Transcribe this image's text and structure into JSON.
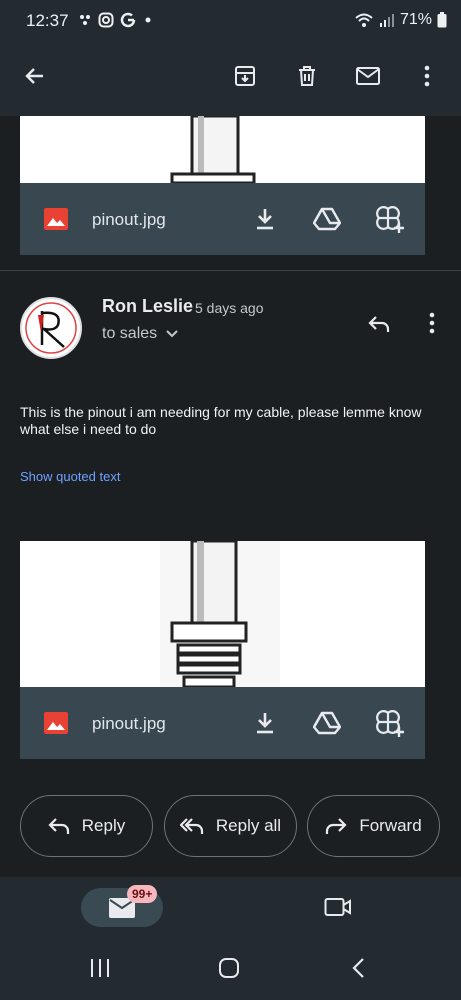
{
  "status": {
    "time": "12:37",
    "battery": "71%"
  },
  "attachments": [
    {
      "filename": "pinout.jpg"
    },
    {
      "filename": "pinout.jpg"
    }
  ],
  "message": {
    "sender": "Ron Leslie",
    "time": "5 days ago",
    "recipient": "to sales",
    "body": "This is the pinout i am needing for my cable, please lemme know what else i need to do",
    "show_quoted": "Show quoted text"
  },
  "actions": {
    "reply": "Reply",
    "reply_all": "Reply all",
    "forward": "Forward"
  },
  "bottom_nav": {
    "mail_badge": "99+"
  },
  "colors": {
    "background": "#1b1f22",
    "bar": "#242b30",
    "attachment_bar": "#394850",
    "link": "#6ea1ff",
    "image_icon": "#e94235"
  }
}
